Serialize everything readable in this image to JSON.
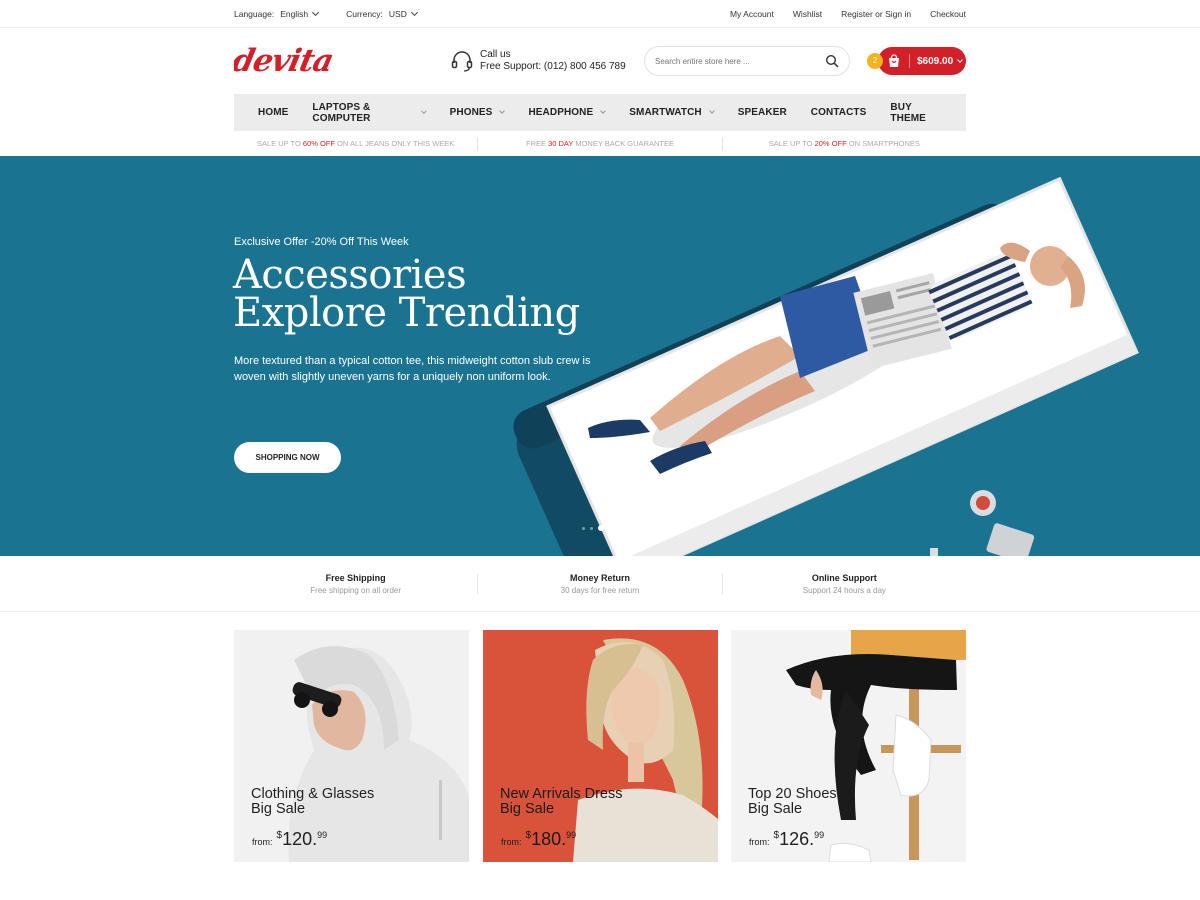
{
  "topbar": {
    "language_label": "Language:",
    "language_value": "English",
    "currency_label": "Currency:",
    "currency_value": "USD",
    "links": [
      "My Account",
      "Wishlist",
      "Register or Sign in",
      "Checkout"
    ]
  },
  "header": {
    "logo_text": "devita",
    "support_line1": "Call us",
    "support_line2": "Free Support: (012) 800 456 789",
    "search_placeholder": "Search entire store here ...",
    "cart_count": "2",
    "cart_total": "$609.00"
  },
  "nav": {
    "items": [
      {
        "label": "HOME",
        "dropdown": false
      },
      {
        "label": "LAPTOPS & COMPUTER",
        "dropdown": true
      },
      {
        "label": "PHONES",
        "dropdown": true
      },
      {
        "label": "HEADPHONE",
        "dropdown": true
      },
      {
        "label": "SMARTWATCH",
        "dropdown": true
      },
      {
        "label": "SPEAKER",
        "dropdown": false
      },
      {
        "label": "CONTACTS",
        "dropdown": false
      },
      {
        "label": "BUY THEME",
        "dropdown": false
      }
    ]
  },
  "promos": [
    {
      "pre": "SALE UP TO ",
      "hl": "60% OFF",
      "post": " ON ALL JEANS ONLY THIS WEEK"
    },
    {
      "pre": "FREE ",
      "hl": "30 DAY",
      "post": " MONEY BACK GUARANTEE"
    },
    {
      "pre": "SALE UP TO ",
      "hl": "20% OFF",
      "post": " ON SMARTPHONES"
    }
  ],
  "hero": {
    "offer": "Exclusive Offer -20% Off This Week",
    "title_line1": "Accessories",
    "title_line2": "Explore Trending",
    "description": "More textured than a typical cotton tee, this midweight cotton slub crew is woven with slightly uneven yarns for a uniquely non uniform look.",
    "button": "SHOPPING NOW",
    "bg_color": "#1a7391"
  },
  "features": [
    {
      "title": "Free Shipping",
      "subtitle": "Free shipping on all order"
    },
    {
      "title": "Money Return",
      "subtitle": "30 days for free return"
    },
    {
      "title": "Online Support",
      "subtitle": "Support 24 hours a day"
    }
  ],
  "banners": [
    {
      "line1": "Clothing & Glasses",
      "line2": "Big Sale",
      "from": "from:",
      "currency": "$",
      "price": "120.",
      "cents": "99"
    },
    {
      "line1": "New Arrivals Dress",
      "line2": "Big Sale",
      "from": "from:",
      "currency": "$",
      "price": "180.",
      "cents": "99"
    },
    {
      "line1": "Top 20 Shoes",
      "line2": "Big Sale",
      "from": "from:",
      "currency": "$",
      "price": "126.",
      "cents": "99"
    }
  ],
  "colors": {
    "accent": "#d21f28",
    "badge": "#f6b21c",
    "hero": "#1a7391",
    "banner_red": "#d9533b"
  }
}
